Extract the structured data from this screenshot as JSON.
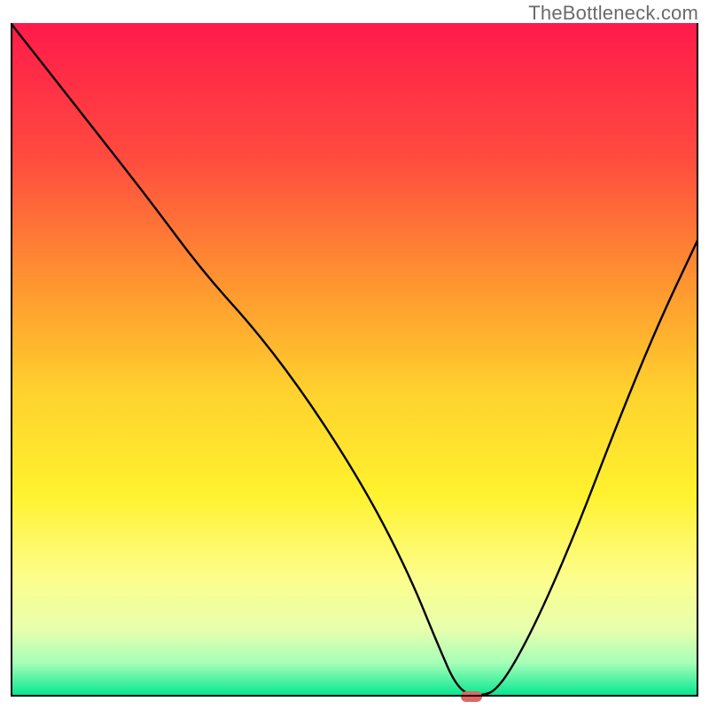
{
  "watermark": "TheBottleneck.com",
  "chart_data": {
    "type": "line",
    "title": "",
    "xlabel": "",
    "ylabel": "",
    "xlim": [
      0,
      100
    ],
    "ylim": [
      0,
      100
    ],
    "grid": false,
    "background_gradient": {
      "orientation": "vertical",
      "stops": [
        {
          "pos": 0.0,
          "color": "#ff1a4b"
        },
        {
          "pos": 0.2,
          "color": "#ff4b3f"
        },
        {
          "pos": 0.4,
          "color": "#ff9a2f"
        },
        {
          "pos": 0.55,
          "color": "#ffd22e"
        },
        {
          "pos": 0.7,
          "color": "#fff22e"
        },
        {
          "pos": 0.82,
          "color": "#fdfd8a"
        },
        {
          "pos": 0.9,
          "color": "#e8ffad"
        },
        {
          "pos": 0.95,
          "color": "#a6ffb8"
        },
        {
          "pos": 1.0,
          "color": "#00e58f"
        }
      ]
    },
    "series": [
      {
        "name": "bottleneck-curve",
        "color": "#000000",
        "x": [
          0,
          10,
          20,
          28,
          36,
          44,
          52,
          58,
          62,
          65,
          68,
          71,
          76,
          82,
          88,
          94,
          100
        ],
        "y": [
          100,
          87,
          74,
          63,
          54,
          43,
          30,
          18,
          8,
          1,
          0,
          1,
          10,
          24,
          40,
          55,
          68
        ]
      }
    ],
    "marker": {
      "name": "optimal-point",
      "shape": "pill",
      "color": "#e06666",
      "x": 67,
      "y": 0,
      "width_pct": 3.2,
      "height_pct": 1.6
    }
  }
}
